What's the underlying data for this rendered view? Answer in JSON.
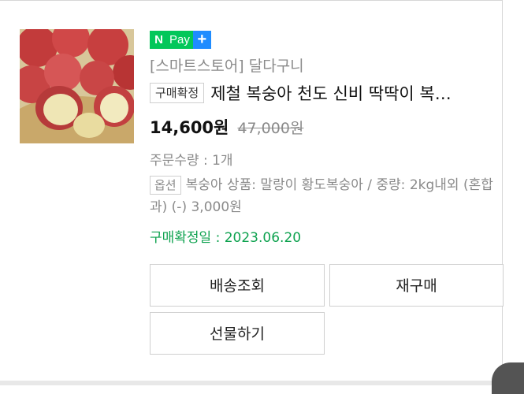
{
  "product": {
    "image_alt": "peaches",
    "pay_badge": {
      "n": "N",
      "pay": "Pay",
      "plus": "+"
    },
    "store": "[스마트스토어] 달다구니",
    "status_badge": "구매확정",
    "title": "제철 복숭아 천도 신비 딱딱이 복…",
    "price": "14,600원",
    "original_price": "47,000원",
    "quantity": "주문수량 : 1개",
    "option_badge": "옵션",
    "option_text": "복숭아 상품: 말랑이 황도복숭아 / 중량: 2kg내외 (혼합과) (-) 3,000원",
    "confirm_date": "구매확정일 : 2023.06.20"
  },
  "buttons": {
    "track": "배송조회",
    "rebuy": "재구매",
    "gift": "선물하기"
  },
  "colors": {
    "naver_green": "#03c75a",
    "plus_blue": "#1f8cff",
    "confirm_green": "#0ea24f"
  }
}
